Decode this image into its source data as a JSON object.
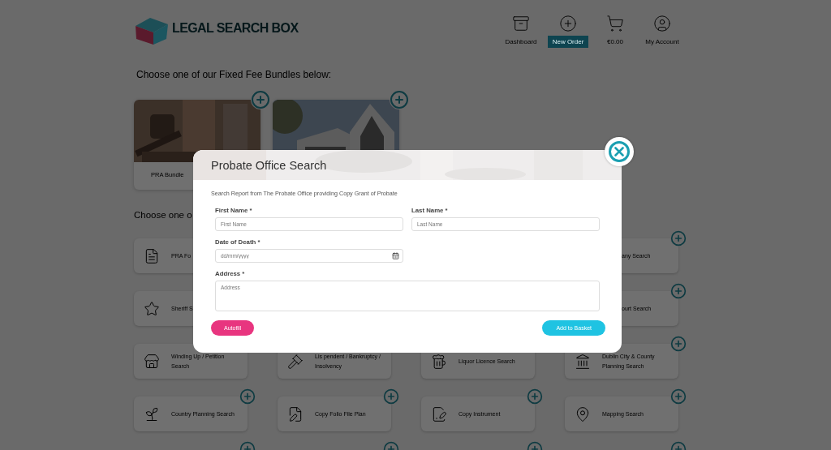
{
  "header": {
    "logo": "LEGAL SEARCH BOX",
    "nav": [
      {
        "label": "Dashboard",
        "selected": false
      },
      {
        "label": "New Order",
        "selected": true
      },
      {
        "label": "€0.00",
        "selected": false
      },
      {
        "label": "My Account",
        "selected": false
      }
    ]
  },
  "bundles": {
    "heading": "Choose one of our Fixed Fee Bundles below:",
    "items": [
      {
        "kind": "picture",
        "label": "PRA Bundle"
      },
      {
        "kind": "picture"
      }
    ]
  },
  "searches": {
    "heading": "Choose one o",
    "rows": [
      [
        {
          "kind": "card",
          "label": "PRA Fo",
          "plus": false
        },
        {
          "kind": "covered"
        },
        {
          "kind": "covered"
        },
        {
          "kind": "partial",
          "label": "any Search",
          "plus": true
        }
      ],
      [
        {
          "kind": "card",
          "label": "Sheriff S",
          "plus": false
        },
        {
          "kind": "covered"
        },
        {
          "kind": "covered"
        },
        {
          "kind": "partial",
          "label": "ourt Search",
          "plus": true
        }
      ],
      [
        {
          "kind": "card",
          "label": "Winding Up / Petition Search",
          "plus": false
        },
        {
          "kind": "card",
          "label": "Lis pendent / Bankruptcy / Insolvency",
          "plus": false
        },
        {
          "kind": "card",
          "label": "Liquor Licence Search",
          "plus": false
        },
        {
          "kind": "card",
          "label": "Dublin City & County Planning Search",
          "plus": true
        }
      ],
      [
        {
          "kind": "card",
          "label": "Country Planning Search",
          "plus": true
        },
        {
          "kind": "card",
          "label": "Copy Folio File Plan",
          "plus": true
        },
        {
          "kind": "card",
          "label": "Copy Instrument",
          "plus": true
        },
        {
          "kind": "card",
          "label": "Mapping Search",
          "plus": true
        }
      ],
      [
        {
          "kind": "cut"
        },
        {
          "kind": "cut"
        },
        {
          "kind": "cut"
        },
        {
          "kind": "cut"
        }
      ]
    ]
  },
  "modal": {
    "title": "Probate Office Search",
    "description": "Search Report from The Probate Office providing Copy Grant of Probate",
    "fields": [
      {
        "kind": "text",
        "label": "First Name *",
        "placeholder": "First Name"
      },
      {
        "kind": "text",
        "label": "Last Name *",
        "placeholder": "Last Name"
      },
      {
        "kind": "date",
        "label": "Date of Death *",
        "placeholder": "dd/mm/yyyy"
      },
      {
        "kind": "textarea",
        "label": "Address *",
        "placeholder": "Address"
      }
    ],
    "buttons": [
      {
        "kind": "secondary",
        "label": "Autofill"
      },
      {
        "kind": "primary",
        "label": "Add to Basket"
      }
    ]
  }
}
